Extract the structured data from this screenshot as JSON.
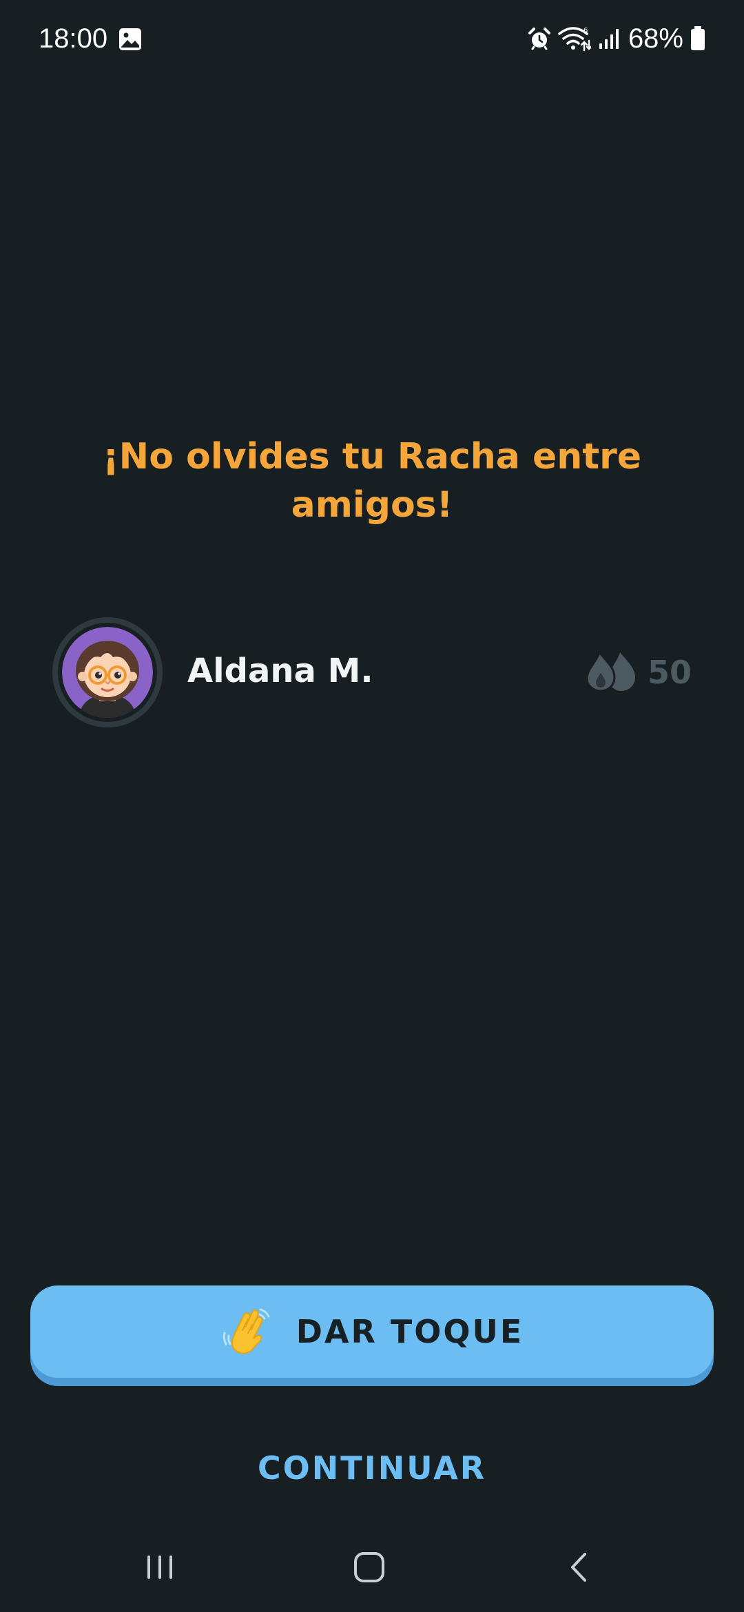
{
  "status_bar": {
    "time": "18:00",
    "battery": "68%",
    "icons": [
      "gallery-icon",
      "alarm-icon",
      "wifi-icon",
      "signal-icon",
      "battery-icon"
    ]
  },
  "headline": "¡No olvides tu Racha entre amigos!",
  "friend": {
    "name": "Aldana M.",
    "streak": "50",
    "avatar_icon": "avatar-girl-glasses",
    "streak_icon": "friend-streak-flames-icon"
  },
  "actions": {
    "poke_label": "DAR TOQUE",
    "poke_icon": "waving-hand-icon",
    "continue_label": "CONTINUAR"
  },
  "nav": {
    "icons": [
      "recents-icon",
      "home-icon",
      "back-icon"
    ]
  },
  "colors": {
    "background": "#181f23",
    "accent_orange": "#f4a63b",
    "accent_blue": "#6cbdf1",
    "muted_gray": "#4d5a61"
  }
}
